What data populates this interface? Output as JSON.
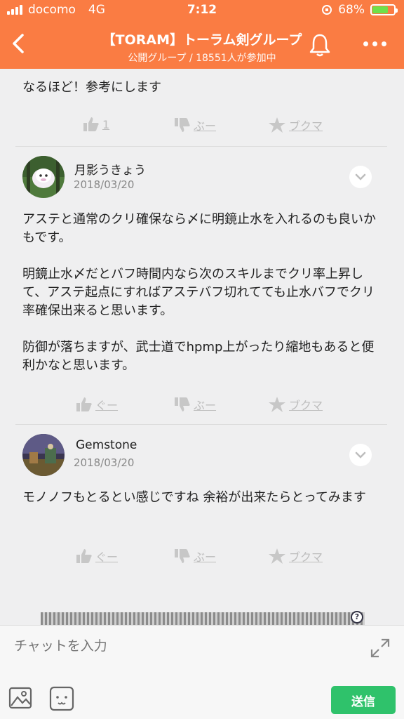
{
  "status_bar": {
    "carrier": "docomo",
    "network": "4G",
    "time": "7:12",
    "battery_percent": "68%",
    "battery_level": 0.68
  },
  "header": {
    "title": "【TORAM】トーラム剣グループ",
    "subtitle": "公開グループ / 18551人が参加中",
    "background": "#fa7c43"
  },
  "messages": [
    {
      "text": "なるほど！参考にします",
      "actions": {
        "like": "1",
        "dislike": "ぶー",
        "bookmark": "ブクマ"
      }
    },
    {
      "author": "月影うきょう",
      "date": "2018/03/20",
      "text": "アステと通常のクリ確保なら〆に明鏡止水を入れるのも良いかもです。\n\n明鏡止水〆だとバフ時間内なら次のスキルまでクリ率上昇して、アステ起点にすればアステバフ切れてても止水バフでクリ率確保出来ると思います。\n\n防御が落ちますが、武士道でhpmp上がったり縮地もあると便利かなと思います。",
      "actions": {
        "like": "ぐー",
        "dislike": "ぶー",
        "bookmark": "ブクマ"
      }
    },
    {
      "author": "Gemstone",
      "date": "2018/03/20",
      "text": "モノノフもとるとい感じですね 余裕が出来たらとってみます",
      "actions": {
        "like": "ぐー",
        "dislike": "ぶー",
        "bookmark": "ブクマ"
      }
    }
  ],
  "ad": {
    "help": "?"
  },
  "composer": {
    "placeholder": "チャットを入力",
    "send_label": "送信",
    "send_color": "#2fc26b"
  },
  "icons": [
    "back-arrow-icon",
    "bell-icon",
    "more-icon",
    "thumbs-up-icon",
    "thumbs-down-icon",
    "star-icon",
    "chevron-down-icon",
    "expand-icon",
    "image-icon",
    "emoji-icon"
  ]
}
